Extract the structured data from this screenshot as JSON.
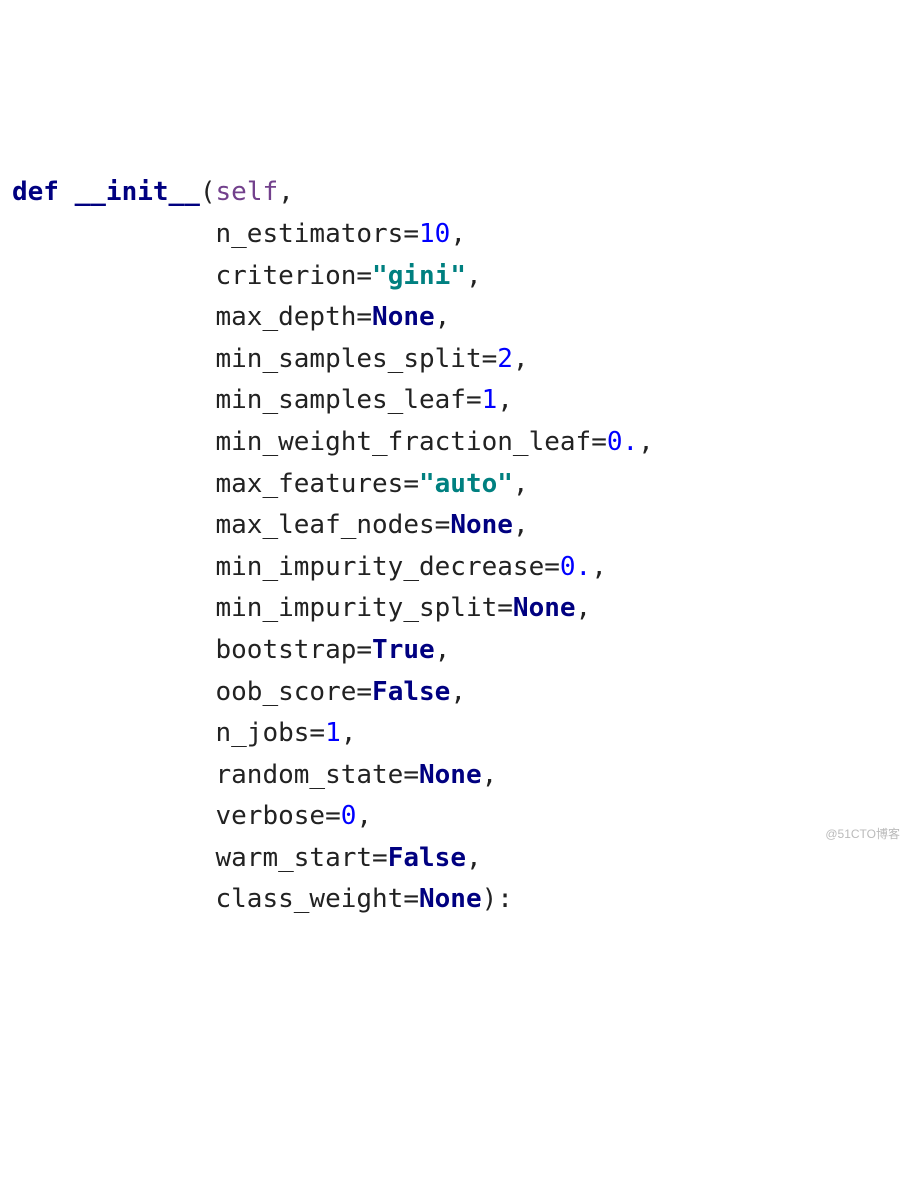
{
  "code": {
    "kw_def": "def",
    "func_name": "__init__",
    "args": {
      "self": "self",
      "n_estimators": {
        "name": "n_estimators",
        "value": "10",
        "vclass": "num"
      },
      "criterion": {
        "name": "criterion",
        "value": "\"gini\"",
        "vclass": "str"
      },
      "max_depth": {
        "name": "max_depth",
        "value": "None",
        "vclass": "cnst"
      },
      "min_samples_split": {
        "name": "min_samples_split",
        "value": "2",
        "vclass": "num"
      },
      "min_samples_leaf": {
        "name": "min_samples_leaf",
        "value": "1",
        "vclass": "num"
      },
      "min_weight_fraction_leaf": {
        "name": "min_weight_fraction_leaf",
        "value": "0.",
        "vclass": "num"
      },
      "max_features": {
        "name": "max_features",
        "value": "\"auto\"",
        "vclass": "str"
      },
      "max_leaf_nodes": {
        "name": "max_leaf_nodes",
        "value": "None",
        "vclass": "cnst"
      },
      "min_impurity_decrease": {
        "name": "min_impurity_decrease",
        "value": "0.",
        "vclass": "num"
      },
      "min_impurity_split": {
        "name": "min_impurity_split",
        "value": "None",
        "vclass": "cnst"
      },
      "bootstrap": {
        "name": "bootstrap",
        "value": "True",
        "vclass": "cnst"
      },
      "oob_score": {
        "name": "oob_score",
        "value": "False",
        "vclass": "cnst"
      },
      "n_jobs": {
        "name": "n_jobs",
        "value": "1",
        "vclass": "num"
      },
      "random_state": {
        "name": "random_state",
        "value": "None",
        "vclass": "cnst"
      },
      "verbose": {
        "name": "verbose",
        "value": "0",
        "vclass": "num"
      },
      "warm_start": {
        "name": "warm_start",
        "value": "False",
        "vclass": "cnst"
      },
      "class_weight": {
        "name": "class_weight",
        "value": "None",
        "vclass": "cnst"
      }
    },
    "indent_first": "             ",
    "indent_rest": "             "
  },
  "watermark": "@51CTO博客"
}
